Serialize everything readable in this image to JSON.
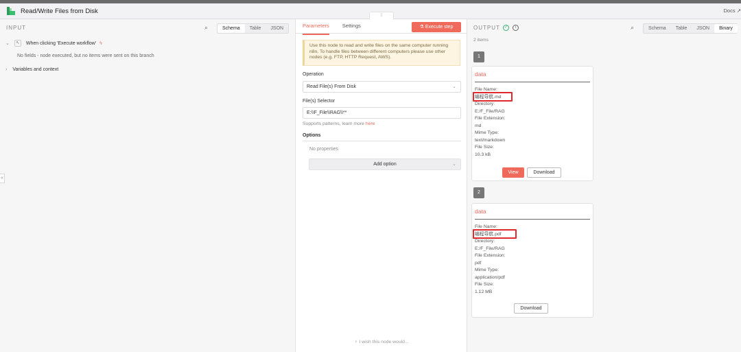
{
  "app": {
    "title": "Read/Write Files from Disk",
    "docs": "Docs",
    "brand_color": "#ef6a5a"
  },
  "input": {
    "label": "INPUT",
    "view_tabs": [
      "Schema",
      "Table",
      "JSON"
    ],
    "active_tab": "Schema",
    "trigger": "When clicking 'Execute workflow'",
    "no_fields": "No fields - node executed, but no items were sent on this branch",
    "variables": "Variables and context"
  },
  "params": {
    "tabs": [
      "Parameters",
      "Settings"
    ],
    "active_tab": "Parameters",
    "execute_label": "Execute step",
    "notice": "Use this node to read and write files on the same computer running n8n. To handle files between different computers please use other nodes (e.g. FTP, HTTP Request, AWS).",
    "operation_label": "Operation",
    "operation_value": "Read File(s) From Disk",
    "selector_label": "File(s) Selector",
    "selector_value": "E:\\\\F_File\\\\RAG\\\\**",
    "hint_text": "Supports patterns, learn more ",
    "hint_link": "here",
    "options_label": "Options",
    "no_properties": "No properties",
    "add_option": "Add option",
    "wish": "I wish this node would..."
  },
  "output": {
    "label": "OUTPUT",
    "view_tabs": [
      "Schema",
      "Table",
      "JSON",
      "Binary"
    ],
    "active_tab": "Binary",
    "count": "2 items",
    "items": [
      {
        "index": "1",
        "title": "data",
        "file_name_label": "File Name:",
        "file_name": "编程导航.md",
        "directory_label": "Directory:",
        "directory": "E:/F_File/RAG",
        "ext_label": "File Extension:",
        "ext": "md",
        "mime_label": "Mime Type:",
        "mime": "text/markdown",
        "size_label": "File Size:",
        "size": "10.3 kB",
        "view": "View",
        "download": "Download"
      },
      {
        "index": "2",
        "title": "data",
        "file_name_label": "File Name:",
        "file_name": "编程导航.pdf",
        "directory_label": "Directory:",
        "directory": "E:/F_File/RAG",
        "ext_label": "File Extension:",
        "ext": "pdf",
        "mime_label": "Mime Type:",
        "mime": "application/pdf",
        "size_label": "File Size:",
        "size": "1.12 MB",
        "download": "Download"
      }
    ]
  }
}
